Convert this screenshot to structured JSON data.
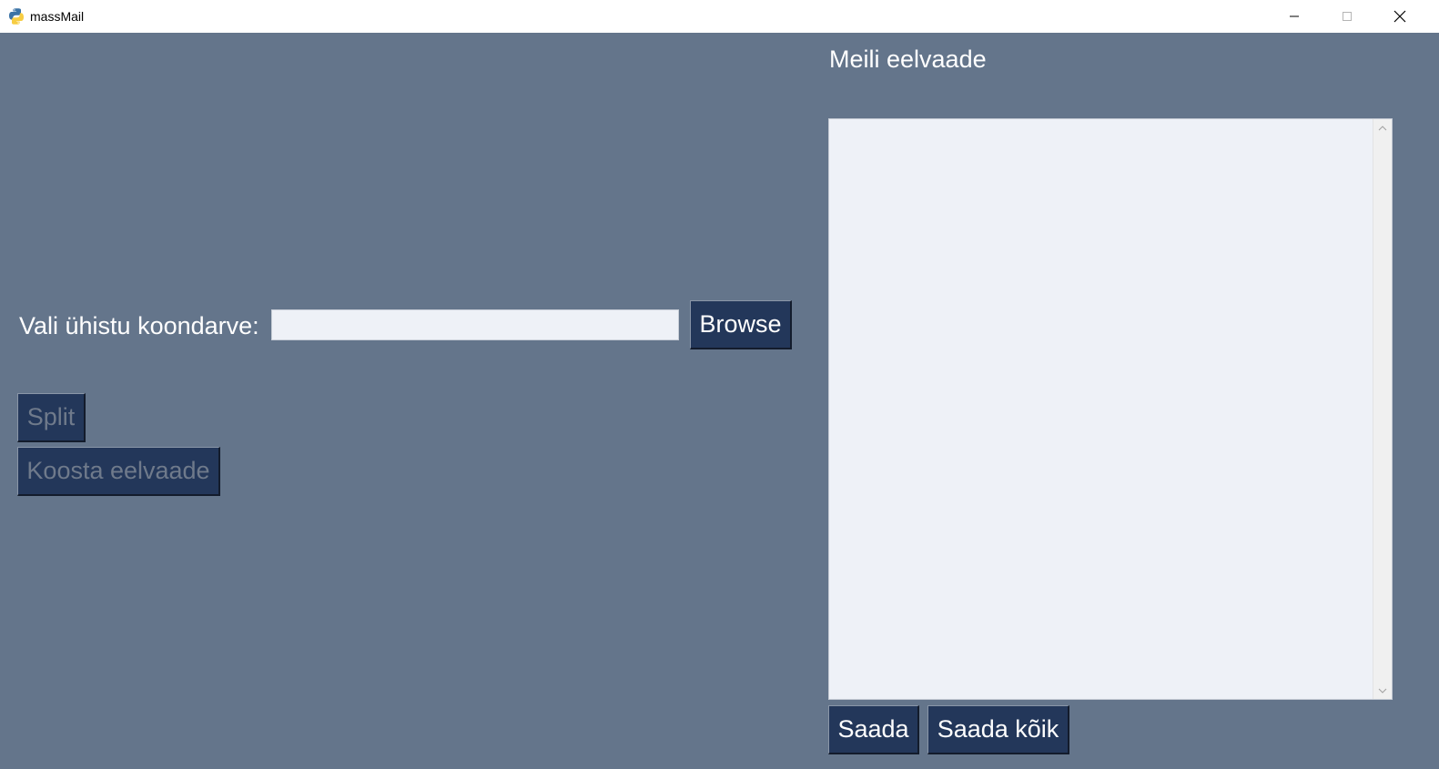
{
  "window": {
    "title": "massMail",
    "icon": "python-icon",
    "controls": [
      "minimize-icon",
      "maximize-icon",
      "close-icon"
    ]
  },
  "left": {
    "file_label": "Vali ühistu koondarve:",
    "file_input_value": "",
    "browse_label": "Browse",
    "split_label": "Split",
    "split_disabled": true,
    "koosta_label": "Koosta eelvaade",
    "koosta_disabled": true
  },
  "right": {
    "preview_title": "Meili eelvaade",
    "preview_text": "",
    "saada_label": "Saada",
    "saada_koik_label": "Saada kõik"
  },
  "colors": {
    "background": "#64758b",
    "button": "#23375a",
    "button_text": "#ffffff",
    "disabled_text": "#6f7a8b",
    "input_bg": "#eef1f7"
  }
}
